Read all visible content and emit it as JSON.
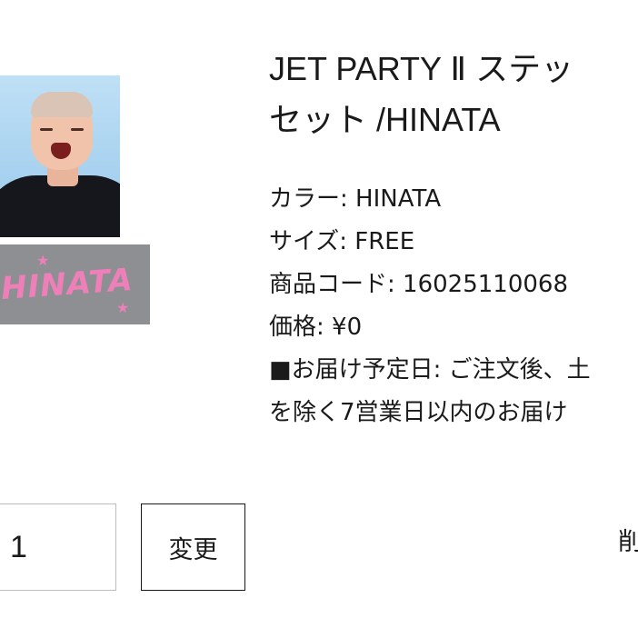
{
  "product": {
    "title_line1": "JET PARTY Ⅱ ステッ",
    "title_line2": "セット /HINATA",
    "logo_text": "HINATA",
    "attributes": [
      "カラー: HINATA",
      "サイズ: FREE",
      "商品コード: 16025110068",
      "価格: ¥0",
      "■お届け予定日: ご注文後、土",
      "を除く7営業日以内のお届け"
    ]
  },
  "cart": {
    "quantity": "1",
    "change_label": "変更",
    "delete_label": "削"
  }
}
